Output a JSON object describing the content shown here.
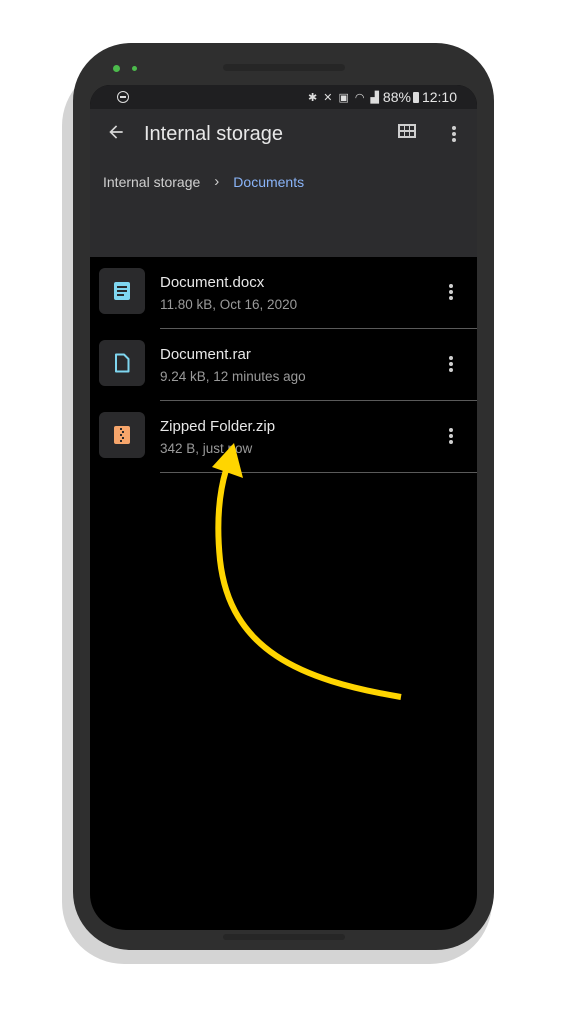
{
  "status_bar": {
    "left_icon": "do-not-disturb-icon",
    "icons": [
      "bluetooth-icon",
      "mute-icon",
      "battery-saver-icon",
      "wifi-icon",
      "signal-icon"
    ],
    "battery_percent": "88%",
    "time": "12:10"
  },
  "app_bar": {
    "back_icon": "arrow-left-icon",
    "title": "Internal storage",
    "grid_icon": "grid-view-icon",
    "more_icon": "more-vert-icon"
  },
  "breadcrumb": {
    "items": [
      "Internal storage",
      "Documents"
    ],
    "separator": "›"
  },
  "files": [
    {
      "name": "Document.docx",
      "meta": "11.80 kB, Oct 16, 2020",
      "icon": "document-icon",
      "icon_color": "#7fd6f0"
    },
    {
      "name": "Document.rar",
      "meta": "9.24 kB, 12 minutes ago",
      "icon": "file-icon",
      "icon_color": "#7fd6f0"
    },
    {
      "name": "Zipped Folder.zip",
      "meta": "342 B, just now",
      "icon": "zip-icon",
      "icon_color": "#f6a56b"
    }
  ],
  "annotation": {
    "type": "curved-arrow",
    "color": "#ffd500",
    "points_to": "Zipped Folder.zip"
  },
  "colors": {
    "accent": "#8ab4f8",
    "appbar": "#2c2c2e",
    "background": "#000000"
  }
}
